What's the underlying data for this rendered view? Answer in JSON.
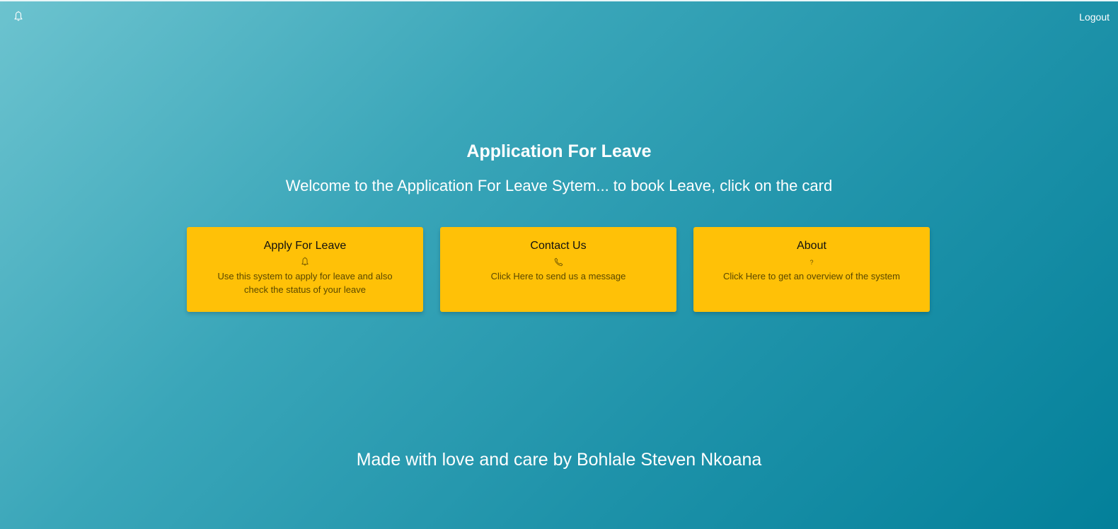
{
  "header": {
    "notification_icon": "bell-icon",
    "logout_label": "Logout"
  },
  "main": {
    "title": "Application For Leave",
    "subtitle": "Welcome to the Application For Leave Sytem... to book Leave, click on the card",
    "cards": [
      {
        "title": "Apply For Leave",
        "icon": "bell-icon",
        "description": "Use this system to apply for leave and also check the status of your leave"
      },
      {
        "title": "Contact Us",
        "icon": "phone-icon",
        "description": "Click Here to send us a message"
      },
      {
        "title": "About",
        "icon": "question-icon",
        "icon_text": "?",
        "description": "Click Here to get an overview of the system"
      }
    ]
  },
  "footer": {
    "credit": "Made with love and care by Bohlale Steven Nkoana"
  },
  "colors": {
    "background_start": "#6cc3cf",
    "background_end": "#03809a",
    "card_background": "#ffc107",
    "text_light": "#ffffff"
  }
}
